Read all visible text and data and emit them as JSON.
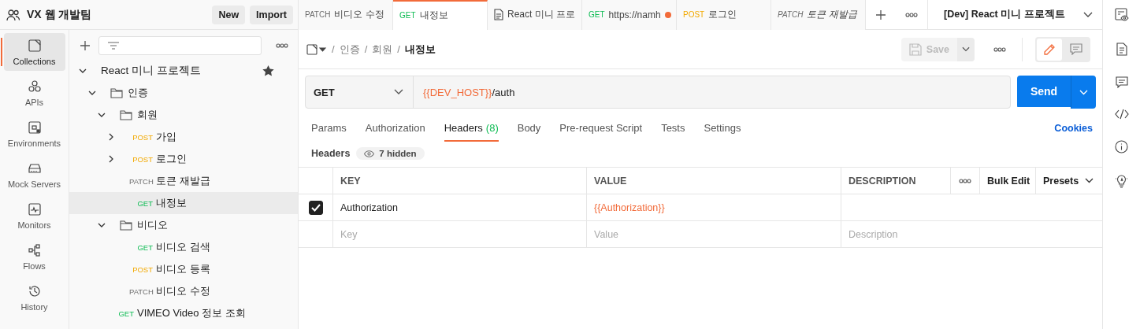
{
  "workspace": {
    "name": "VX 웹 개발팀",
    "buttons": [
      "New",
      "Import"
    ]
  },
  "nav": [
    {
      "label": "Collections",
      "selected": true
    },
    {
      "label": "APIs",
      "selected": false
    },
    {
      "label": "Environments",
      "selected": false
    },
    {
      "label": "Mock Servers",
      "selected": false
    },
    {
      "label": "Monitors",
      "selected": false
    },
    {
      "label": "Flows",
      "selected": false
    },
    {
      "label": "History",
      "selected": false
    }
  ],
  "tree": [
    {
      "kind": "collection",
      "name": "React 미니 프로젝트",
      "expanded": true,
      "starred": true,
      "selected": false,
      "children": [
        {
          "kind": "folder",
          "name": "인증",
          "expanded": true,
          "selected": false,
          "children": [
            {
              "kind": "folder",
              "name": "회원",
              "expanded": true,
              "selected": false,
              "children": [
                {
                  "kind": "request",
                  "method": "POST",
                  "name": "가입",
                  "expandable": true,
                  "selected": false
                },
                {
                  "kind": "request",
                  "method": "POST",
                  "name": "로그인",
                  "expandable": true,
                  "selected": false
                },
                {
                  "kind": "request",
                  "method": "PATCH",
                  "name": "토큰 재발급",
                  "expandable": false,
                  "selected": false
                },
                {
                  "kind": "request",
                  "method": "GET",
                  "name": "내정보",
                  "expandable": false,
                  "selected": true
                }
              ]
            },
            {
              "kind": "folder",
              "name": "비디오",
              "expanded": true,
              "selected": false,
              "children": [
                {
                  "kind": "request",
                  "method": "GET",
                  "name": "비디오 검색",
                  "expandable": false,
                  "selected": false
                },
                {
                  "kind": "request",
                  "method": "POST",
                  "name": "비디오 등록",
                  "expandable": false,
                  "selected": false
                },
                {
                  "kind": "request",
                  "method": "PATCH",
                  "name": "비디오 수정",
                  "expandable": false,
                  "selected": false
                }
              ]
            }
          ]
        },
        {
          "kind": "request",
          "method": "GET",
          "name": "VIMEO Video 정보 조회",
          "expandable": false,
          "selected": false
        }
      ]
    }
  ],
  "tabs": [
    {
      "kind": "request",
      "method": "PATCH",
      "title": "비디오 수정",
      "selected": false,
      "unsaved": false,
      "preview": false
    },
    {
      "kind": "request",
      "method": "GET",
      "title": "내정보",
      "selected": true,
      "unsaved": false,
      "preview": false
    },
    {
      "kind": "doc",
      "title": "React 미니 프로",
      "selected": false,
      "unsaved": false,
      "preview": false
    },
    {
      "kind": "request",
      "method": "GET",
      "title": "https://namh",
      "selected": false,
      "unsaved": true,
      "preview": false
    },
    {
      "kind": "request",
      "method": "POST",
      "title": "로그인",
      "selected": false,
      "unsaved": false,
      "preview": false
    },
    {
      "kind": "request",
      "method": "PATCH",
      "title": "토큰 재발급",
      "selected": false,
      "unsaved": false,
      "preview": true
    }
  ],
  "environment": "[Dev] React 미니 프로젝트",
  "breadcrumb": [
    {
      "separator": "/",
      "label": "인증"
    },
    {
      "separator": "/",
      "label": "회원"
    },
    {
      "separator": "/",
      "label": "내정보"
    }
  ],
  "save": {
    "label": "Save",
    "disabled": true
  },
  "request": {
    "method": "GET",
    "url_variable": "{{DEV_HOST}}",
    "url_path": "/auth"
  },
  "send": "Send",
  "request_tabs": [
    {
      "label": "Params",
      "selected": false
    },
    {
      "label": "Authorization",
      "selected": false
    },
    {
      "label": "Headers",
      "count": "(8)",
      "selected": true
    },
    {
      "label": "Body",
      "selected": false
    },
    {
      "label": "Pre-request Script",
      "selected": false
    },
    {
      "label": "Tests",
      "selected": false
    },
    {
      "label": "Settings",
      "selected": false
    }
  ],
  "cookies": "Cookies",
  "headers": {
    "title": "Headers",
    "hidden": "7 hidden",
    "columns": [
      "KEY",
      "VALUE",
      "DESCRIPTION"
    ],
    "bulk_edit": "Bulk Edit",
    "presets": "Presets",
    "rows": [
      {
        "key": "Authorization",
        "value": "{{Authorization}}",
        "checked": true
      }
    ],
    "new_row": [
      {
        "placeholder": "Key"
      },
      {
        "placeholder": "Value"
      },
      {
        "placeholder": "Description"
      }
    ]
  }
}
